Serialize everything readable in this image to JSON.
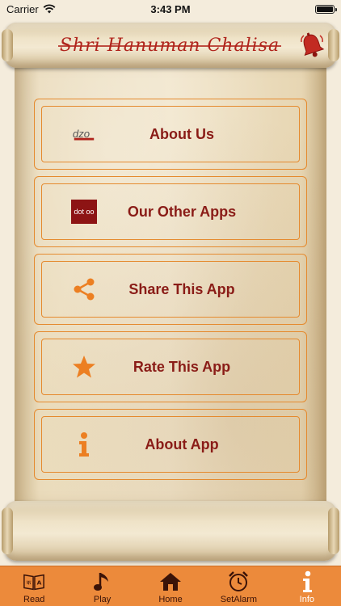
{
  "status_bar": {
    "carrier": "Carrier",
    "time": "3:43 PM"
  },
  "header": {
    "title": "Shri Hanuman Chalisa"
  },
  "menu": {
    "items": [
      {
        "label": "About Us",
        "icon": "dzo-logo",
        "logo_text": "dzo"
      },
      {
        "label": "Our Other Apps",
        "icon": "dotoo-logo",
        "logo_text": "dot oo"
      },
      {
        "label": "Share This App",
        "icon": "share-icon"
      },
      {
        "label": "Rate This App",
        "icon": "star-icon"
      },
      {
        "label": "About App",
        "icon": "info-icon"
      }
    ]
  },
  "tab_bar": {
    "tabs": [
      {
        "label": "Read",
        "icon": "read-book-icon"
      },
      {
        "label": "Play",
        "icon": "music-note-icon"
      },
      {
        "label": "Home",
        "icon": "home-icon"
      },
      {
        "label": "SetAlarm",
        "icon": "alarm-clock-icon"
      },
      {
        "label": "Info",
        "icon": "info-icon",
        "active": true
      }
    ]
  },
  "colors": {
    "accent": "#e58a2e",
    "label": "#8a1c17",
    "title": "#b0241c",
    "tab_bar": "#ec8a3b"
  }
}
